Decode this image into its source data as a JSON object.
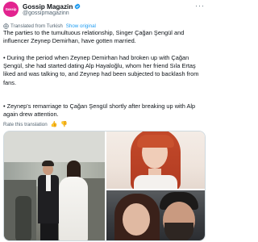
{
  "author": {
    "avatar_text": "Gossip",
    "display_name": "Gossip Magazin",
    "handle": "@gossipmagazinn",
    "verified_icon": "verified-badge-icon"
  },
  "more_icon": "more-options-icon",
  "translation": {
    "label": "Translated from Turkish",
    "link": "Show original"
  },
  "paragraphs": [
    "The parties to the tumultuous relationship, Singer Çağan Şengül and influencer Zeynep Demirhan, have gotten married.",
    "• During the period when Zeynep Demirhan had broken up with Çağan Şengül, she had started dating Alp Hayaloğlu, whom her friend Sıla Ertaş liked and was talking to, and Zeynep had been subjected to backlash from fans.",
    "• Zeynep's remarriage to Çağan Şengül shortly after breaking up with Alp again drew attention."
  ],
  "rate": {
    "label": "Rate this translation",
    "up_icon": "thumbs-up-icon",
    "down_icon": "thumbs-down-icon"
  },
  "media": {
    "colors": {
      "accent": "#1d9bf0",
      "brand": "#e2238f"
    }
  }
}
